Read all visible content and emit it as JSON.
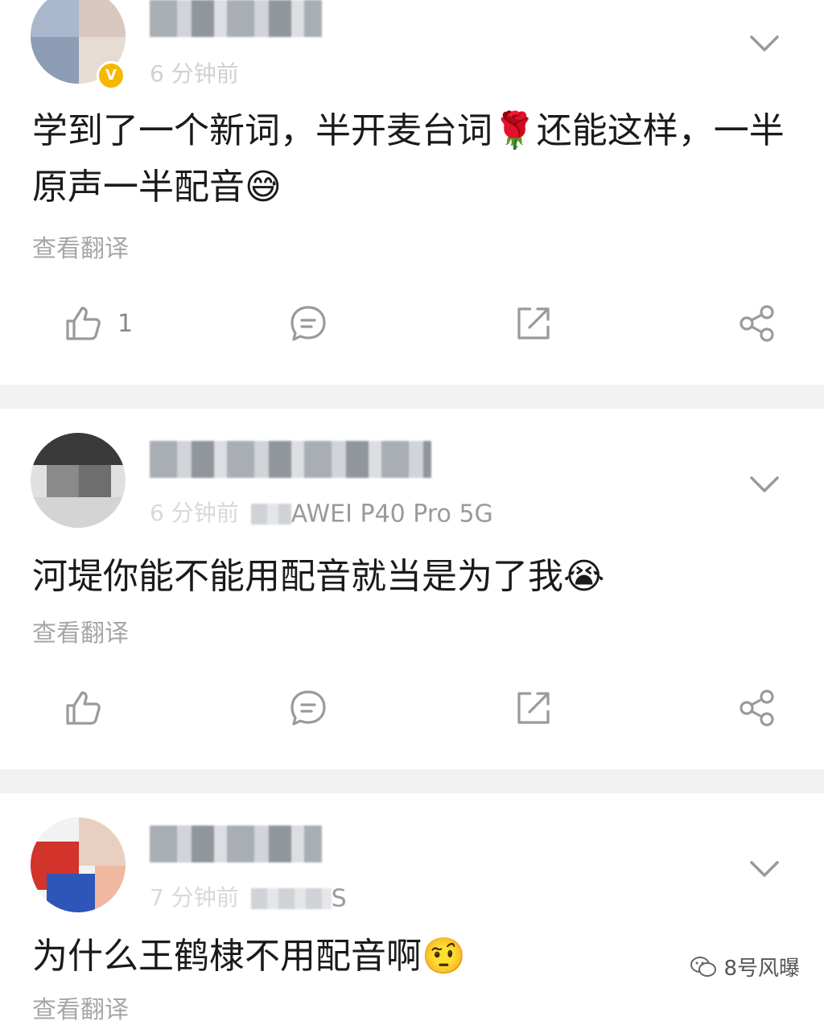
{
  "comments": [
    {
      "time_text": "6 分钟前",
      "text": "学到了一个新词，半开麦台词🌹还能这样，一半原声一半配音😅",
      "translate": "查看翻译",
      "like_count": "1",
      "verified": true
    },
    {
      "time_text": "6 分钟前",
      "device": "HUAWEI P40 Pro 5G",
      "device_visible": "AWEI P40 Pro 5G",
      "text": "河堤你能不能用配音就当是为了我😭",
      "translate": "查看翻译",
      "like_count": ""
    },
    {
      "time_text": "7 分钟前",
      "device_visible": "S",
      "text": "为什么王鹤棣不用配音啊🤨",
      "translate": "查看翻译"
    }
  ],
  "watermark": {
    "label": "8号风曝"
  },
  "icons": [
    "like-icon",
    "comment-icon",
    "repost-icon",
    "share-icon",
    "chevron-down-icon"
  ],
  "colors": {
    "separator": "#f2f2f2",
    "icon": "#9a9a9a",
    "verified": "#f5b800"
  }
}
